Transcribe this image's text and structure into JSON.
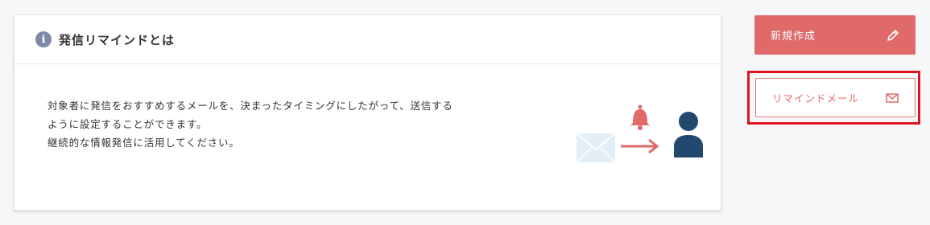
{
  "card": {
    "title": "発信リマインドとは",
    "info_icon": "i",
    "description_lines": [
      "対象者に発信をおすすめするメールを、決まったタイミングにしたがって、送信する",
      "ように設定することができます。",
      "継続的な情報発信に活用してください。"
    ]
  },
  "buttons": {
    "new_label": "新規作成",
    "new_icon": "pencil-icon",
    "remind_label": "リマインドメール",
    "remind_icon": "mail-icon"
  },
  "colors": {
    "accent": "#e06a6a",
    "highlight": "#e0131f",
    "navy": "#23486f",
    "envelope": "#e3edf5",
    "info": "#7f88a6"
  }
}
